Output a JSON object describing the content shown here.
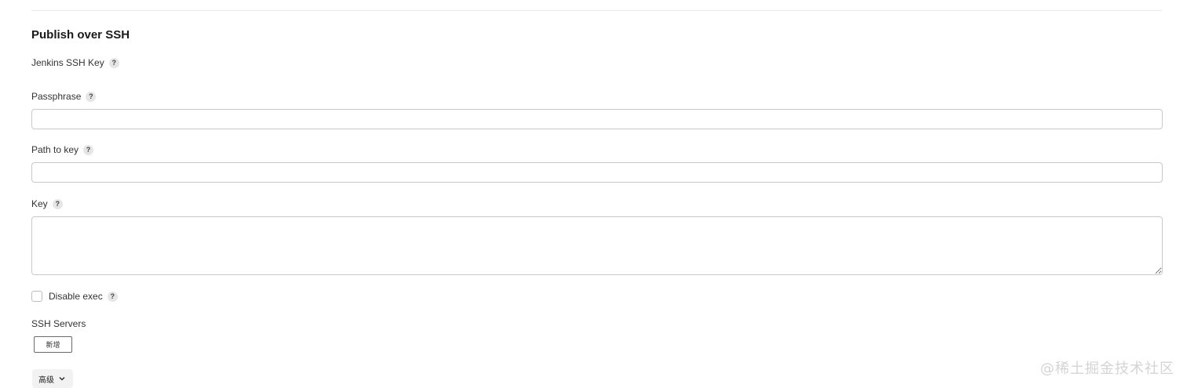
{
  "section": {
    "title": "Publish over SSH"
  },
  "fields": {
    "jenkins_ssh_key": {
      "label": "Jenkins SSH Key",
      "help": "?"
    },
    "passphrase": {
      "label": "Passphrase",
      "help": "?",
      "value": ""
    },
    "path_to_key": {
      "label": "Path to key",
      "help": "?",
      "value": ""
    },
    "key": {
      "label": "Key",
      "help": "?",
      "value": ""
    },
    "disable_exec": {
      "label": "Disable exec",
      "help": "?",
      "checked": false
    }
  },
  "ssh_servers": {
    "label": "SSH Servers",
    "add_label": "新增"
  },
  "advanced": {
    "label": "高级",
    "icon": "chevron-down-icon"
  },
  "watermark": "@稀土掘金技术社区",
  "colors": {
    "border": "#c9c9c9",
    "help_bg": "#e6e6e6",
    "advanced_bg": "#f2f2f2"
  }
}
